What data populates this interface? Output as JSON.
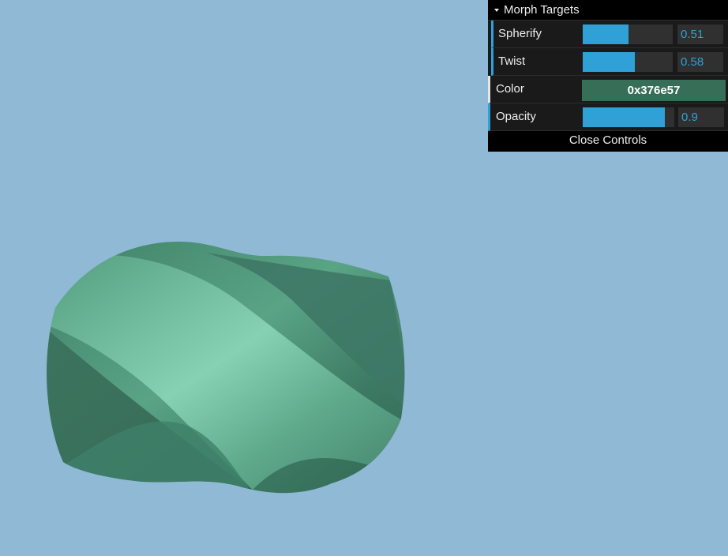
{
  "gui": {
    "folder_title": "Morph Targets",
    "controllers": [
      {
        "label": "Spherify",
        "value": "0.51",
        "fraction": 0.51
      },
      {
        "label": "Twist",
        "value": "0.58",
        "fraction": 0.58
      }
    ],
    "color": {
      "label": "Color",
      "value": "0x376e57",
      "hex": "#376e57"
    },
    "opacity": {
      "label": "Opacity",
      "value": "0.9",
      "fraction": 0.9
    },
    "close_label": "Close Controls"
  },
  "scene": {
    "background": "#8fb9d5",
    "mesh_color": "#376e57",
    "mesh_highlight": "#7ecfb2"
  }
}
